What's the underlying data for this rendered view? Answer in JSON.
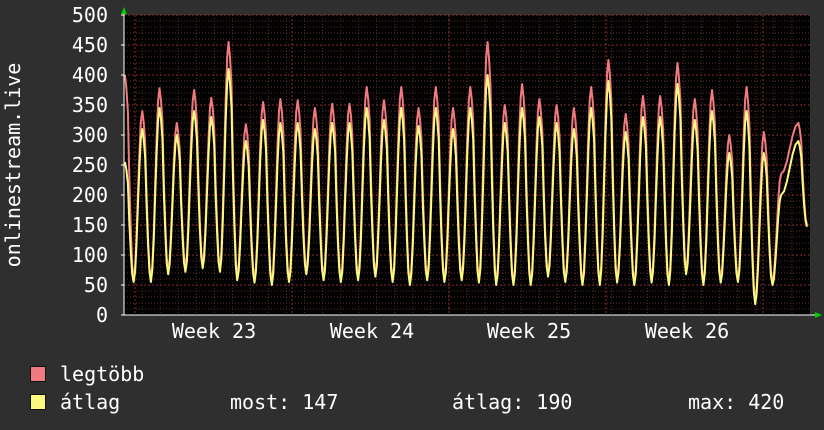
{
  "chart_data": {
    "type": "line",
    "ylabel": "onlinestream.live",
    "ylim": [
      0,
      500
    ],
    "y_ticks": [
      0,
      50,
      100,
      150,
      200,
      250,
      300,
      350,
      400,
      450,
      500
    ],
    "x_tick_labels": [
      "Week 23",
      "Week 24",
      "Week 25",
      "Week 26"
    ],
    "grid": true,
    "legend_placement": "bottom-left",
    "series": [
      {
        "name": "legtöbb",
        "color": "#f07a7d",
        "peaks": [
          400,
          340,
          378,
          320,
          375,
          362,
          455,
          318,
          355,
          360,
          358,
          345,
          352,
          352,
          380,
          358,
          380,
          345,
          380,
          345,
          380,
          455,
          350,
          385,
          360,
          350,
          345,
          380,
          425,
          335,
          365,
          365,
          420,
          360,
          375,
          300,
          380,
          305,
          235,
          320
        ],
        "troughs": [
          60,
          60,
          75,
          80,
          85,
          80,
          65,
          60,
          55,
          60,
          75,
          65,
          60,
          65,
          70,
          60,
          55,
          65,
          60,
          65,
          60,
          55,
          55,
          55,
          70,
          60,
          55,
          55,
          60,
          55,
          60,
          55,
          75,
          55,
          60,
          60,
          25,
          55
        ],
        "last": 150
      },
      {
        "name": "átlag",
        "color": "#fafa80",
        "peaks": [
          255,
          310,
          345,
          300,
          340,
          330,
          410,
          290,
          325,
          320,
          320,
          310,
          320,
          320,
          345,
          325,
          345,
          315,
          345,
          310,
          345,
          400,
          320,
          345,
          330,
          320,
          310,
          345,
          390,
          305,
          330,
          330,
          385,
          325,
          340,
          270,
          340,
          270,
          200,
          290
        ],
        "troughs": [
          55,
          55,
          68,
          72,
          78,
          72,
          58,
          54,
          50,
          55,
          68,
          58,
          55,
          58,
          64,
          55,
          50,
          58,
          55,
          58,
          54,
          50,
          50,
          50,
          64,
          55,
          50,
          50,
          54,
          50,
          54,
          50,
          68,
          50,
          54,
          55,
          18,
          50
        ],
        "last": 147
      }
    ]
  },
  "legend": {
    "items": [
      {
        "label": "legtöbb",
        "color": "#f07a7d"
      },
      {
        "label": "átlag",
        "color": "#fafa80"
      }
    ],
    "stats": {
      "now": "most: 147",
      "avg": "átlag: 190",
      "max": "max: 420"
    }
  },
  "colors": {
    "background": "#2f2f2f",
    "plot_background": "#000000",
    "grid_minor": "#5a2e2e",
    "grid_major": "#8a3030",
    "axis_arrow": "#00cc00"
  }
}
